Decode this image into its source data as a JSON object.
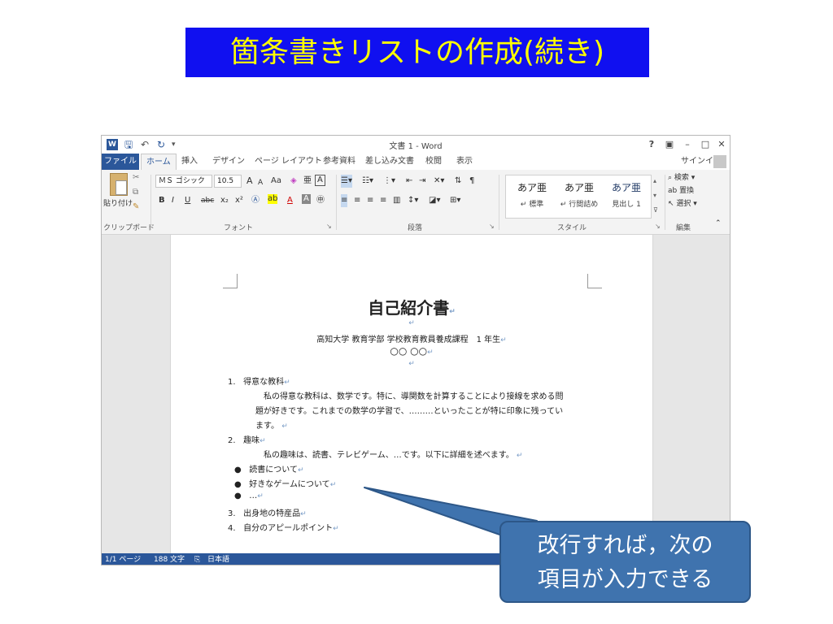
{
  "slide": {
    "title": "箇条書きリストの作成(続き)",
    "callout_line1": "改行すれば，次の",
    "callout_line2": "項目が入力できる"
  },
  "window": {
    "title": "文書 1 - Word",
    "logo": "W",
    "help": "?",
    "signin": "サインイン"
  },
  "tabs": [
    "ファイル",
    "ホーム",
    "挿入",
    "デザイン",
    "ページ レイアウト",
    "参考資料",
    "差し込み文書",
    "校閲",
    "表示"
  ],
  "ribbon": {
    "clipboard_label": "クリップボード",
    "paste_label": "貼り付け",
    "font_name": "ＭＳ ゴシック",
    "font_size": "10.5",
    "font_grow": "A",
    "font_shrink": "A",
    "change_case": "Aa",
    "bold": "B",
    "italic": "I",
    "underline": "U",
    "strike": "abc",
    "subscript": "x₂",
    "superscript": "x²",
    "font_label": "フォント",
    "paragraph_label": "段落",
    "styles": [
      {
        "sample": "あア亜",
        "name": "↵ 標準"
      },
      {
        "sample": "あア亜",
        "name": "↵ 行間詰め"
      },
      {
        "sample": "あア亜",
        "name": "見出し 1"
      }
    ],
    "styles_label": "スタイル",
    "find": "検索",
    "replace": "置換",
    "select": "選択",
    "editing_label": "編集"
  },
  "document": {
    "title": "自己紹介書",
    "affiliation": "高知大学 教育学部 学校教育教員養成課程　1 年生",
    "name": "○○ ○○",
    "para_mark": "↵",
    "item1_num": "1.",
    "item1_label": "得意な教科",
    "item1_line1": "私の得意な教科は、数学です。特に、導関数を計算することにより接線を求める問",
    "item1_line2": "題が好きです。これまでの数学の学習で、………といったことが特に印象に残ってい",
    "item1_line3": "ます。",
    "item2_num": "2.",
    "item2_label": "趣味",
    "item2_line1": "私の趣味は、読書、テレビゲーム、…です。以下に詳細を述べます。",
    "bullet": "●",
    "bullets": [
      "読書について",
      "好きなゲームについて",
      "…"
    ],
    "item3_num": "3.",
    "item3_label": "出身地の特産品",
    "item4_num": "4.",
    "item4_label": "自分のアピールポイント"
  },
  "status": {
    "page": "1/1 ページ",
    "words": "188 文字",
    "language": "日本語"
  }
}
